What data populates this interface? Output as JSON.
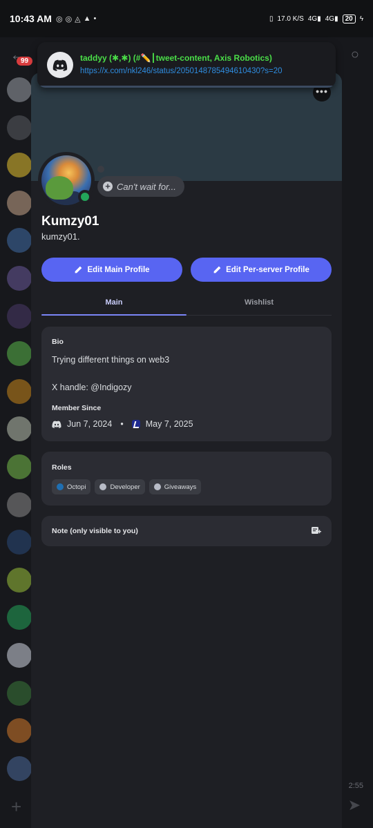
{
  "status_bar": {
    "time": "10:43 AM",
    "network_speed": "17.0",
    "network_unit": "K/S",
    "net1": "4G",
    "net2": "4G",
    "battery": "20"
  },
  "background": {
    "badge": "99",
    "time_fragment": "2:55"
  },
  "notification": {
    "title": "taddyy (✱,✱) (#✏️┃tweet-content, Axis Robotics)",
    "link": "https://x.com/nkl246/status/2050148785494610430?s=20"
  },
  "profile": {
    "status": "Can't wait for...",
    "display_name": "Kumzy01",
    "username": "kumzy01.",
    "edit_main_label": "Edit Main Profile",
    "edit_server_label": "Edit Per-server Profile",
    "tabs": [
      {
        "label": "Main",
        "active": true
      },
      {
        "label": "Wishlist",
        "active": false
      }
    ],
    "bio_title": "Bio",
    "bio_text": "Trying different things on web3\n\nX handle: @Indigozy",
    "member_since_title": "Member Since",
    "discord_join": "Jun 7, 2024",
    "server_join": "May 7, 2025",
    "separator": "•",
    "roles_title": "Roles",
    "roles": [
      {
        "name": "Octopi",
        "color": "#1f6fb2"
      },
      {
        "name": "Developer",
        "color": "#b8bcc7"
      },
      {
        "name": "Giveaways",
        "color": "#b8bcc7"
      }
    ],
    "note_label": "Note (only visible to you)"
  },
  "colors": {
    "blurple": "#5865f2",
    "online": "#23a55a",
    "banner": "#2b3a44",
    "notif_title": "#4ade48",
    "link": "#2f8de0"
  }
}
